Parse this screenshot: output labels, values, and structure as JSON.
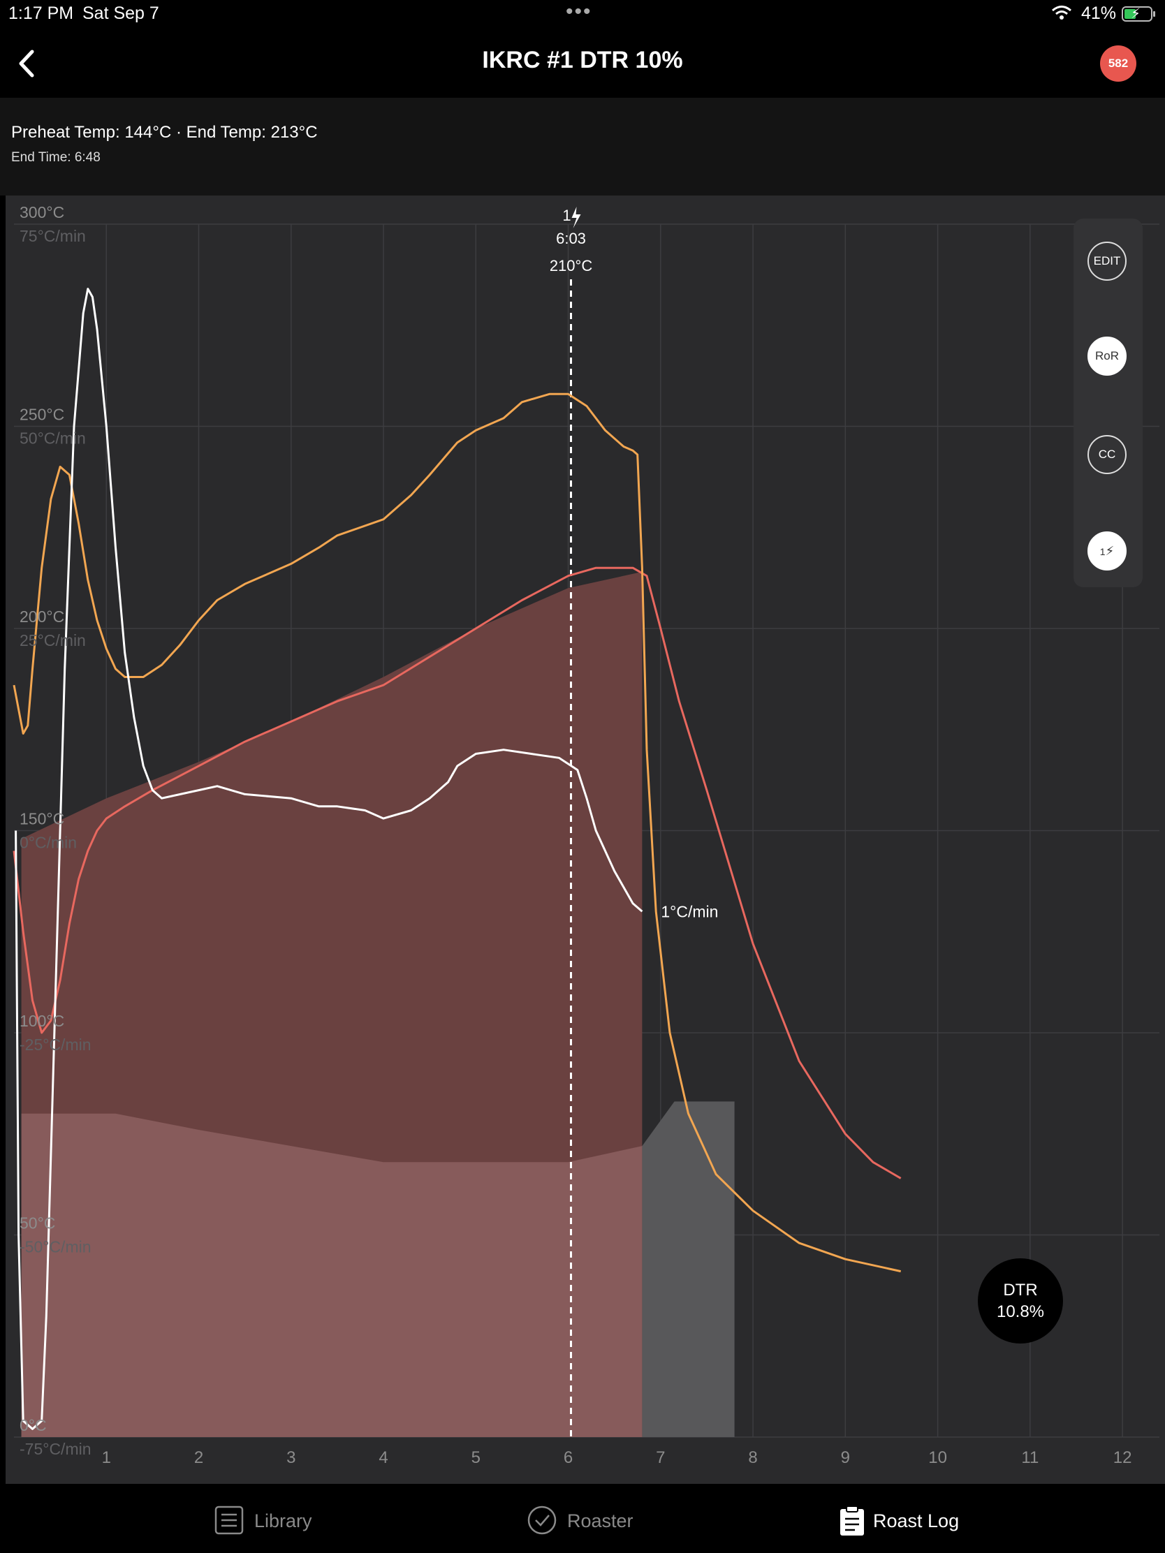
{
  "status_bar": {
    "time": "1:17 PM",
    "date": "Sat Sep 7",
    "battery": "41%"
  },
  "nav": {
    "title": "IKRC #1 DTR 10%",
    "badge": "582"
  },
  "info": {
    "line1": "Preheat Temp: 144°C · End Temp: 213°C",
    "line2": "End Time: 6:48"
  },
  "toolbar": {
    "edit": "EDIT",
    "ror": "RoR",
    "cc": "CC",
    "first_crack": "1"
  },
  "dtr": {
    "label": "DTR",
    "value": "10.8%"
  },
  "tabs": {
    "library": "Library",
    "roaster": "Roaster",
    "roast_log": "Roast Log"
  },
  "colors": {
    "bean_temp": "#e8685f",
    "env_temp": "#f2a651",
    "ror": "#ffffff",
    "power_area": "#6a4140",
    "fan_area": "#875b5b",
    "cooling_area": "#58585a",
    "background": "#2a2a2c"
  },
  "chart_data": {
    "type": "line",
    "x_unit": "minutes",
    "xlim": [
      0,
      12.4
    ],
    "x_ticks": [
      "1",
      "2",
      "3",
      "4",
      "5",
      "6",
      "7",
      "8",
      "9",
      "10",
      "11",
      "12"
    ],
    "y_temp_ticks": [
      "0°C",
      "50°C",
      "100°C",
      "150°C",
      "200°C",
      "250°C",
      "300°C"
    ],
    "y_ror_ticks": [
      "-75°C/min",
      "-50°C/min",
      "-25°C/min",
      "0°C/min",
      "25°C/min",
      "50°C/min",
      "75°C/min"
    ],
    "ylim_temp": [
      0,
      300
    ],
    "ylim_ror": [
      -75,
      75
    ],
    "grid": true,
    "first_crack": {
      "label": "1",
      "time_label": "6:03",
      "temp_label": "210°C",
      "x": 6.03
    },
    "ror_end_label": "1°C/min",
    "series": [
      {
        "key": "bean_temp",
        "points": [
          [
            0,
            145
          ],
          [
            0.1,
            125
          ],
          [
            0.2,
            108
          ],
          [
            0.3,
            100
          ],
          [
            0.4,
            103
          ],
          [
            0.5,
            113
          ],
          [
            0.6,
            127
          ],
          [
            0.7,
            138
          ],
          [
            0.8,
            145
          ],
          [
            0.9,
            150
          ],
          [
            1,
            153
          ],
          [
            1.2,
            156
          ],
          [
            1.5,
            160
          ],
          [
            2,
            166
          ],
          [
            2.5,
            172
          ],
          [
            3,
            177
          ],
          [
            3.5,
            182
          ],
          [
            4,
            186
          ],
          [
            4.5,
            193
          ],
          [
            5,
            200
          ],
          [
            5.5,
            207
          ],
          [
            6,
            213
          ],
          [
            6.3,
            215
          ],
          [
            6.5,
            215
          ],
          [
            6.7,
            215
          ],
          [
            6.85,
            213
          ],
          [
            7,
            200
          ],
          [
            7.2,
            182
          ],
          [
            7.5,
            160
          ],
          [
            8,
            122
          ],
          [
            8.5,
            93
          ],
          [
            9,
            75
          ],
          [
            9.3,
            68
          ],
          [
            9.6,
            64
          ]
        ]
      },
      {
        "key": "env_temp",
        "points": [
          [
            0,
            186
          ],
          [
            0.05,
            180
          ],
          [
            0.1,
            174
          ],
          [
            0.15,
            176
          ],
          [
            0.2,
            190
          ],
          [
            0.3,
            215
          ],
          [
            0.4,
            232
          ],
          [
            0.5,
            240
          ],
          [
            0.6,
            238
          ],
          [
            0.7,
            226
          ],
          [
            0.8,
            212
          ],
          [
            0.9,
            202
          ],
          [
            1,
            195
          ],
          [
            1.1,
            190
          ],
          [
            1.2,
            188
          ],
          [
            1.4,
            188
          ],
          [
            1.6,
            191
          ],
          [
            1.8,
            196
          ],
          [
            2,
            202
          ],
          [
            2.2,
            207
          ],
          [
            2.5,
            211
          ],
          [
            3,
            216
          ],
          [
            3.3,
            220
          ],
          [
            3.5,
            223
          ],
          [
            4,
            227
          ],
          [
            4.3,
            233
          ],
          [
            4.5,
            238
          ],
          [
            4.8,
            246
          ],
          [
            5,
            249
          ],
          [
            5.3,
            252
          ],
          [
            5.5,
            256
          ],
          [
            5.8,
            258
          ],
          [
            6,
            258
          ],
          [
            6.2,
            255
          ],
          [
            6.4,
            249
          ],
          [
            6.6,
            245
          ],
          [
            6.7,
            244
          ],
          [
            6.75,
            243
          ],
          [
            6.8,
            215
          ],
          [
            6.85,
            170
          ],
          [
            6.95,
            130
          ],
          [
            7.1,
            100
          ],
          [
            7.3,
            80
          ],
          [
            7.6,
            65
          ],
          [
            8,
            56
          ],
          [
            8.5,
            48
          ],
          [
            9,
            44
          ],
          [
            9.6,
            41
          ]
        ]
      },
      {
        "key": "ror",
        "points": [
          [
            0.02,
            0
          ],
          [
            0.05,
            -50
          ],
          [
            0.1,
            -73
          ],
          [
            0.2,
            -74
          ],
          [
            0.3,
            -73
          ],
          [
            0.35,
            -60
          ],
          [
            0.45,
            -20
          ],
          [
            0.55,
            20
          ],
          [
            0.65,
            50
          ],
          [
            0.75,
            64
          ],
          [
            0.8,
            67
          ],
          [
            0.85,
            66
          ],
          [
            0.9,
            62
          ],
          [
            1,
            50
          ],
          [
            1.1,
            35
          ],
          [
            1.2,
            22
          ],
          [
            1.3,
            14
          ],
          [
            1.4,
            8
          ],
          [
            1.5,
            5
          ],
          [
            1.6,
            4
          ],
          [
            1.8,
            4.5
          ],
          [
            2,
            5
          ],
          [
            2.2,
            5.5
          ],
          [
            2.5,
            4.5
          ],
          [
            3,
            4
          ],
          [
            3.3,
            3
          ],
          [
            3.5,
            3
          ],
          [
            3.8,
            2.5
          ],
          [
            4,
            1.5
          ],
          [
            4.3,
            2.5
          ],
          [
            4.5,
            4
          ],
          [
            4.7,
            6
          ],
          [
            4.8,
            8
          ],
          [
            5,
            9.5
          ],
          [
            5.3,
            10
          ],
          [
            5.6,
            9.5
          ],
          [
            5.9,
            9
          ],
          [
            6.1,
            7.5
          ],
          [
            6.2,
            4
          ],
          [
            6.3,
            0
          ],
          [
            6.5,
            -5
          ],
          [
            6.7,
            -9
          ],
          [
            6.8,
            -10
          ]
        ]
      }
    ],
    "areas": [
      {
        "key": "power",
        "points": [
          [
            0.08,
            148
          ],
          [
            1,
            158
          ],
          [
            2,
            167
          ],
          [
            3,
            177
          ],
          [
            4,
            188
          ],
          [
            5,
            200
          ],
          [
            6,
            210
          ],
          [
            6.8,
            214
          ],
          [
            6.8,
            0
          ],
          [
            0.08,
            0
          ]
        ]
      },
      {
        "key": "fan",
        "points": [
          [
            0.08,
            80
          ],
          [
            1.1,
            80
          ],
          [
            2,
            76
          ],
          [
            3,
            72
          ],
          [
            4,
            68
          ],
          [
            5,
            68
          ],
          [
            6,
            68
          ],
          [
            6.8,
            72
          ],
          [
            6.8,
            0
          ],
          [
            0.08,
            0
          ]
        ]
      },
      {
        "key": "cooling",
        "points": [
          [
            6.8,
            72
          ],
          [
            7.15,
            83
          ],
          [
            7.8,
            83
          ],
          [
            7.8,
            0
          ],
          [
            6.8,
            0
          ]
        ]
      }
    ]
  }
}
